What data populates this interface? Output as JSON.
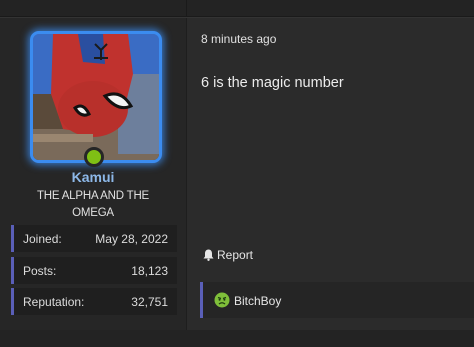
{
  "user": {
    "name": "Kamui",
    "title": "THE ALPHA AND THE OMEGA",
    "online": true,
    "stats": [
      {
        "label": "Joined:",
        "value": "May 28, 2022"
      },
      {
        "label": "Posts:",
        "value": "18,123"
      },
      {
        "label": "Reputation:",
        "value": "32,751"
      }
    ]
  },
  "post": {
    "timestamp": "8 minutes ago",
    "message": "6 is the magic number",
    "report_label": "Report",
    "reactions": [
      {
        "icon": "angry-face-icon",
        "user": "BitchBoy"
      }
    ]
  },
  "colors": {
    "accent_blue": "#3b8cf0",
    "username": "#8db8e8",
    "online": "#7fbf14",
    "stat_border": "#5a5fb8"
  }
}
